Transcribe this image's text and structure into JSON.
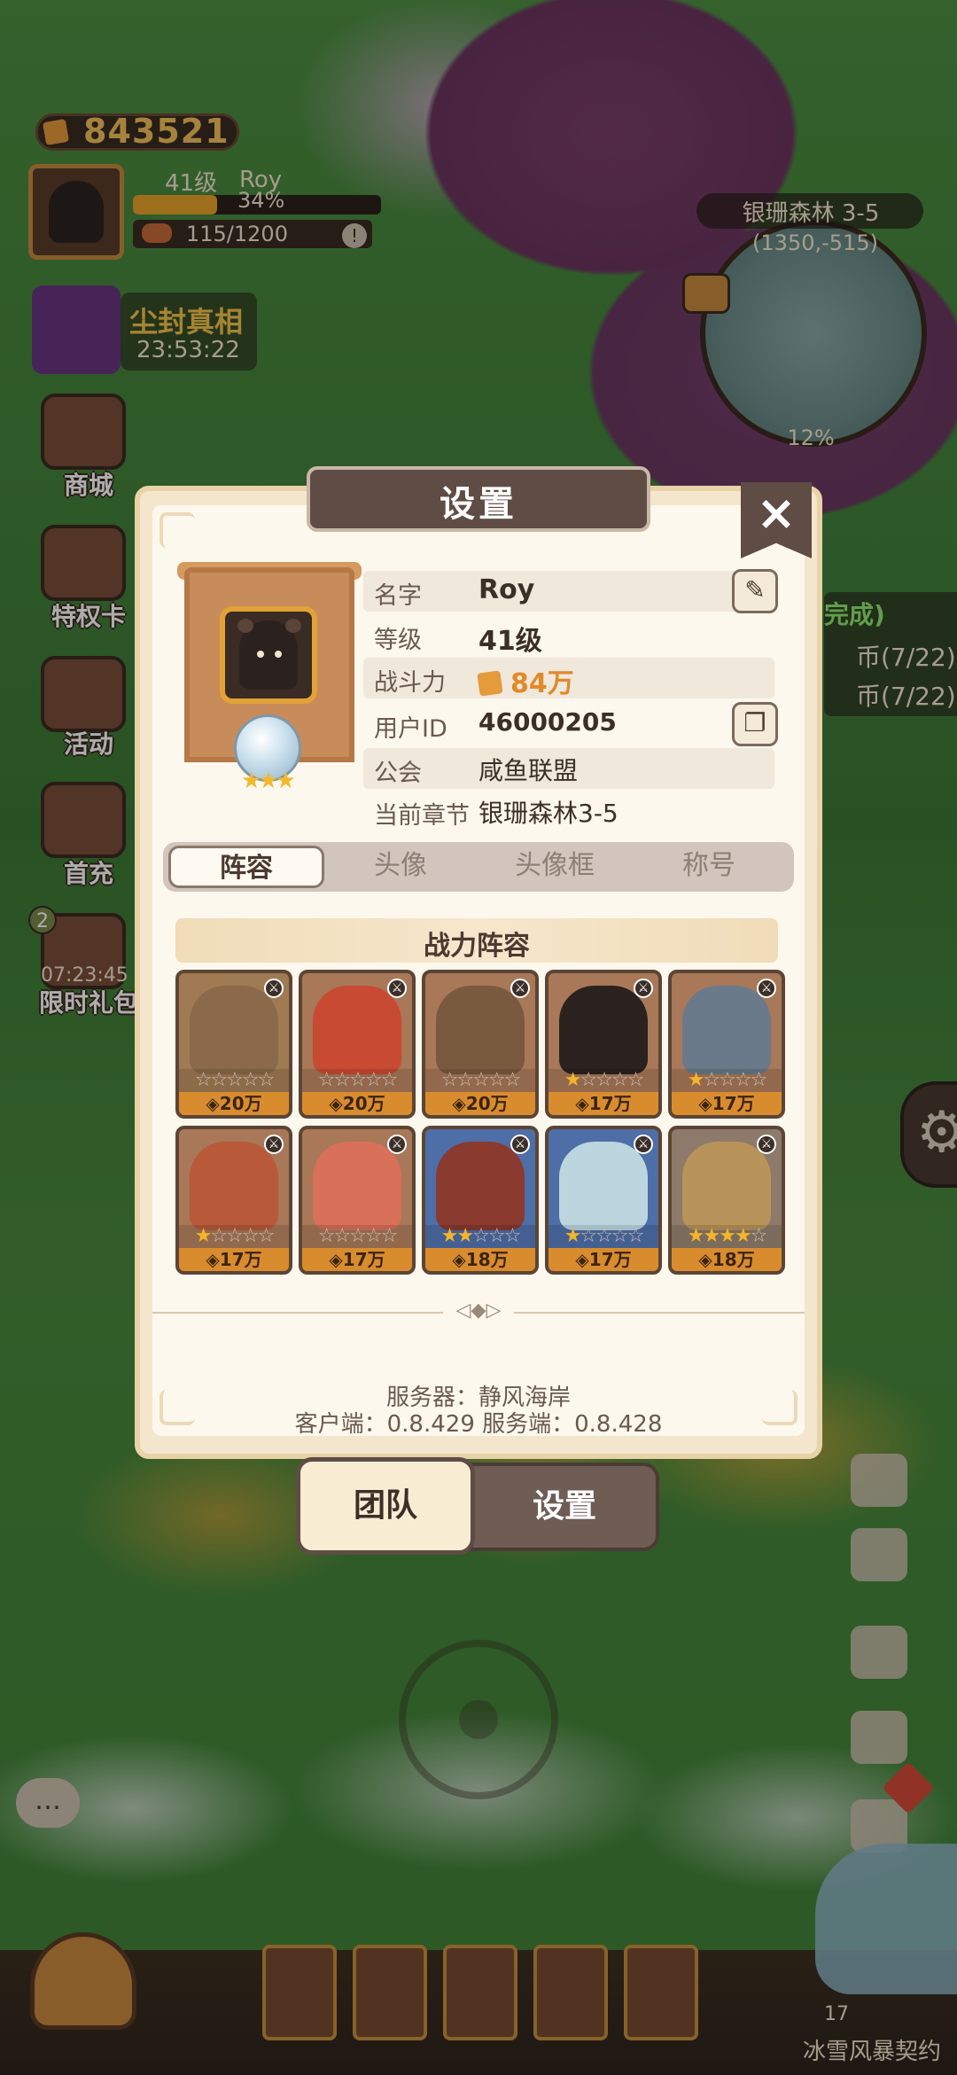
{
  "hud": {
    "coins": "843521",
    "level": "41级",
    "player_name": "Roy",
    "xp_percent": "34%",
    "xp_fraction": 0.34,
    "energy": "115/1200",
    "event_title": "尘封真相",
    "event_timer": "23:53:22",
    "gift_badge": "2",
    "gift_timer": "07:23:45",
    "location": "银珊森林 3-5",
    "coords": "(1350,-515)",
    "map_percent": "12%",
    "side_menu": [
      {
        "label": "商城",
        "icon": "shop-icon"
      },
      {
        "label": "特权卡",
        "icon": "privilege-card-icon"
      },
      {
        "label": "活动",
        "icon": "event-icon"
      },
      {
        "label": "首充",
        "icon": "first-recharge-icon"
      },
      {
        "label": "限时礼包",
        "icon": "gift-icon"
      }
    ],
    "quest_lines": [
      "完成)",
      "币(7/22)",
      "币(7/22)"
    ],
    "storm_label": "冰雪风暴契约",
    "storm_count": "17"
  },
  "dialog": {
    "title": "设置",
    "profile": {
      "name_label": "名字",
      "name": "Roy",
      "level_label": "等级",
      "level": "41级",
      "power_label": "战斗力",
      "power": "84万",
      "uid_label": "用户ID",
      "uid": "46000205",
      "guild_label": "公会",
      "guild": "咸鱼联盟",
      "chapter_label": "当前章节",
      "chapter": "银珊森林3-5"
    },
    "tabs": [
      "阵容",
      "头像",
      "头像框",
      "称号"
    ],
    "lineup_title": "战力阵容",
    "heroes": [
      {
        "power": "20万",
        "stars": 0,
        "bg": "#a07a52",
        "skin": "#8a6a4a"
      },
      {
        "power": "20万",
        "stars": 0,
        "bg": "#a87858",
        "skin": "#c84a32"
      },
      {
        "power": "20万",
        "stars": 0,
        "bg": "#a87858",
        "skin": "#7a5a3e"
      },
      {
        "power": "17万",
        "stars": 1,
        "bg": "#a87858",
        "skin": "#2b221f"
      },
      {
        "power": "17万",
        "stars": 1,
        "bg": "#a87858",
        "skin": "#6a7a8a"
      },
      {
        "power": "17万",
        "stars": 1,
        "bg": "#a87858",
        "skin": "#b85a3a"
      },
      {
        "power": "17万",
        "stars": 0,
        "bg": "#a87858",
        "skin": "#d8705a"
      },
      {
        "power": "18万",
        "stars": 2,
        "bg": "#4e6ea8",
        "skin": "#8a3a2e"
      },
      {
        "power": "17万",
        "stars": 1,
        "bg": "#4e6ea8",
        "skin": "#bcd6e0"
      },
      {
        "power": "18万",
        "stars": 4,
        "bg": "#8d7a6a",
        "skin": "#b8945a"
      }
    ],
    "server_name_line": "服务器：静风海岸",
    "version_line": "客户端：0.8.429  服务端：0.8.428"
  },
  "bottom_tabs": {
    "team": "团队",
    "settings": "设置"
  }
}
